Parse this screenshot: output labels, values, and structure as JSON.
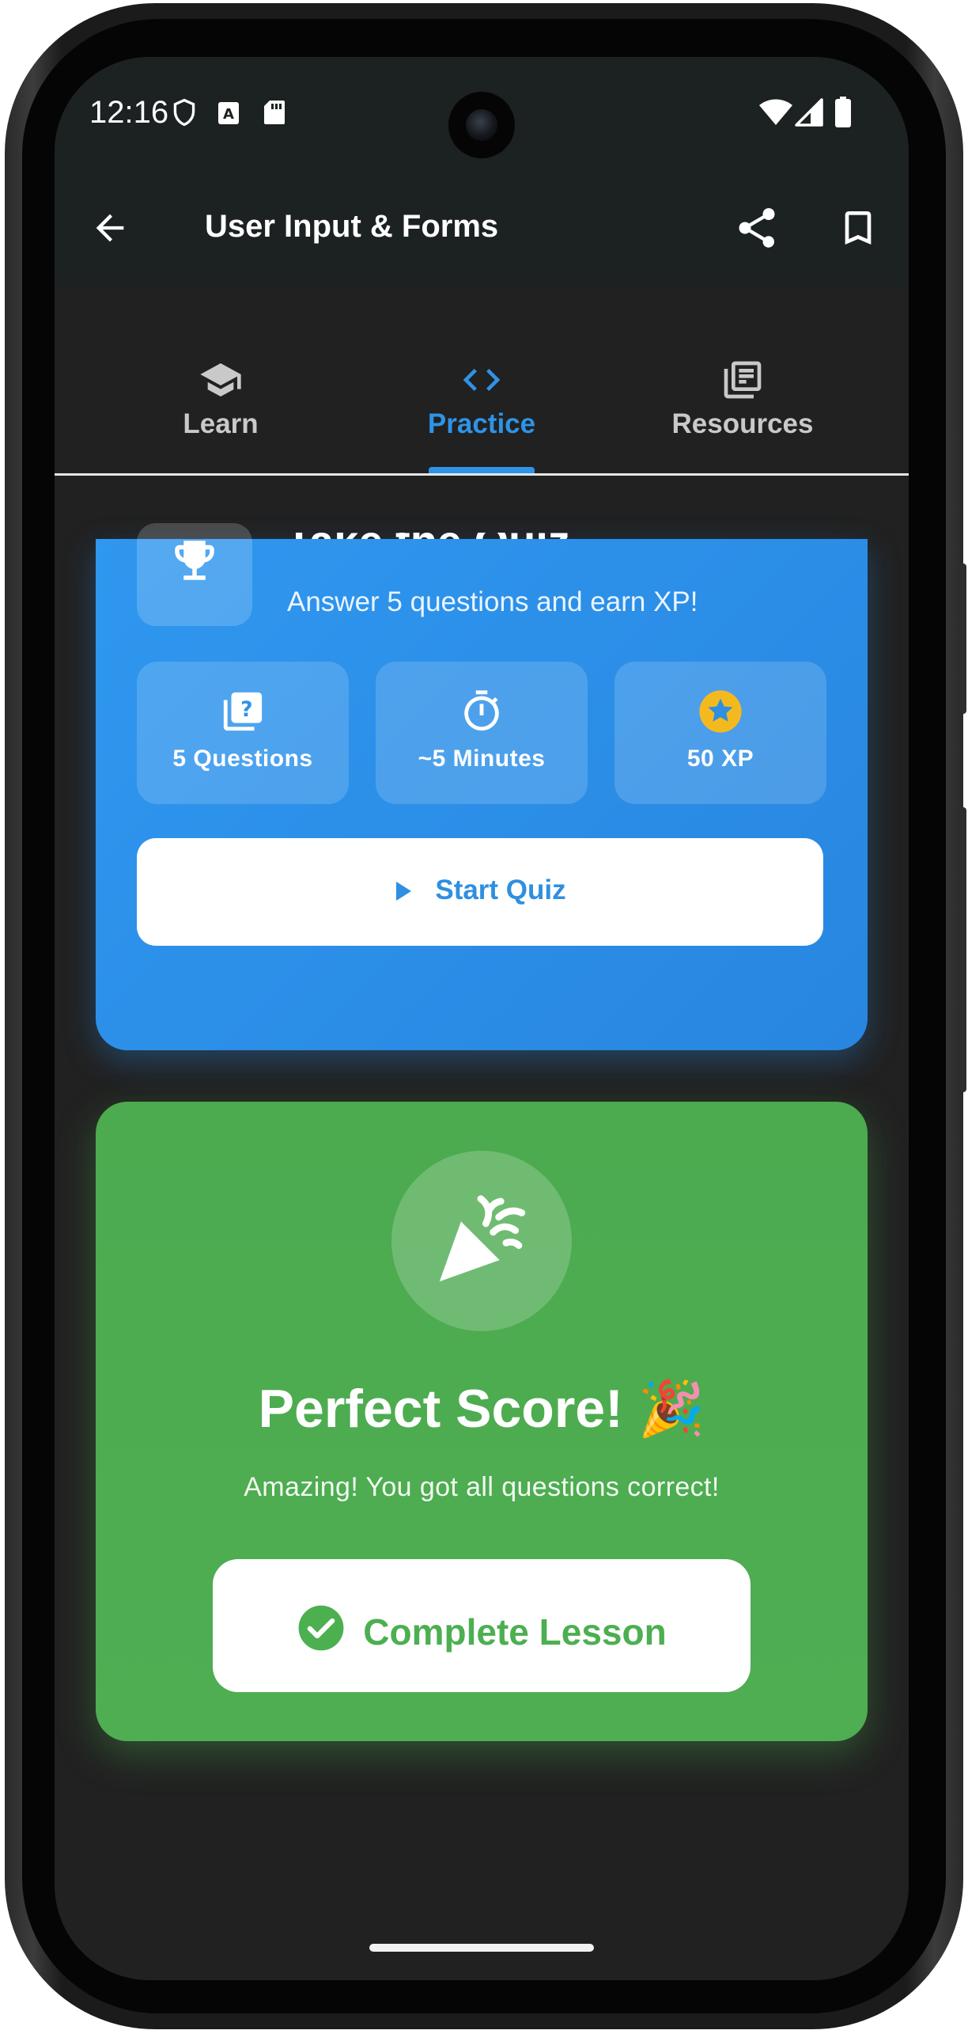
{
  "status_bar": {
    "time": "12:16",
    "icons": [
      "shield-icon",
      "accessibility-notification-icon",
      "sd-card-icon",
      "wifi-icon",
      "signal-icon",
      "battery-icon"
    ]
  },
  "app_bar": {
    "title": "User Input & Forms",
    "icons": [
      "back-arrow-icon",
      "share-icon",
      "bookmark-icon"
    ]
  },
  "tabs": [
    {
      "label": "Learn",
      "icon": "school-cap-icon",
      "active": false
    },
    {
      "label": "Practice",
      "icon": "code-brackets-icon",
      "active": true
    },
    {
      "label": "Resources",
      "icon": "library-books-icon",
      "active": false
    }
  ],
  "quiz_card": {
    "title": "Take the Quiz",
    "subtitle": "Answer 5 questions and earn XP!",
    "stats": [
      {
        "label": "5 Questions",
        "icon": "quiz-icon"
      },
      {
        "label": "~5 Minutes",
        "icon": "timer-icon"
      },
      {
        "label": "50 XP",
        "icon": "star-coin-icon"
      }
    ],
    "start_button": "Start Quiz"
  },
  "score_card": {
    "title": "Perfect Score! 🎉",
    "subtitle": "Amazing! You got all questions correct!",
    "complete_button": "Complete Lesson"
  },
  "colors": {
    "primary_blue": "#2f93e6",
    "success_green": "#4caf50",
    "app_bar_bg": "#1c2121",
    "screen_bg": "#212121"
  }
}
